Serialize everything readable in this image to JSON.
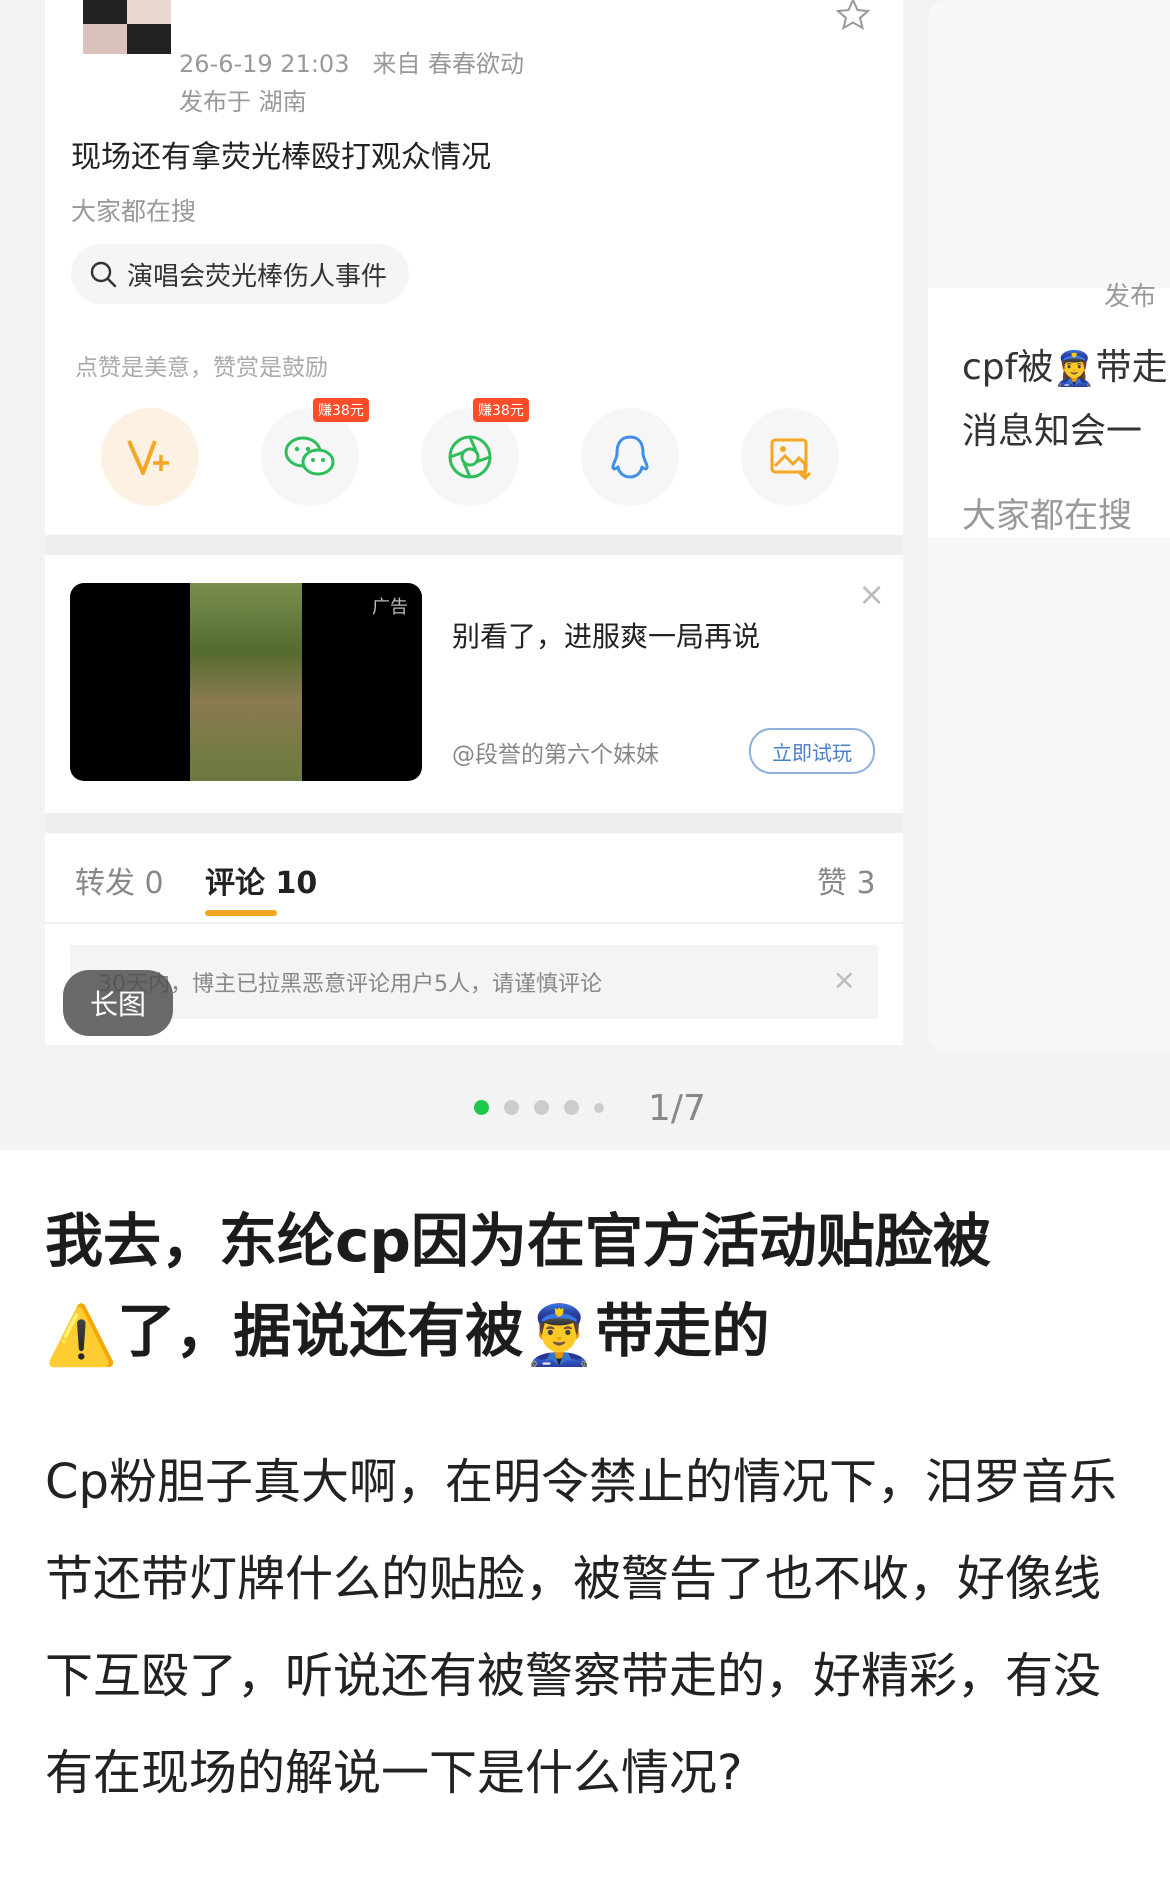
{
  "carousel": {
    "post": {
      "timestamp": "26-6-19 21:03",
      "source_prefix": "来自",
      "source": "春春欲动",
      "location": "发布于 湖南",
      "text": "现场还有拿荧光棒殴打观众情况",
      "trending_label": "大家都在搜",
      "trending_query": "演唱会荧光棒伤人事件",
      "reward_text": "点赞是美意，赞赏是鼓励",
      "share_buttons": [
        {
          "icon": "v-plus-icon",
          "badge": ""
        },
        {
          "icon": "wechat-icon",
          "badge": "赚38元"
        },
        {
          "icon": "moments-icon",
          "badge": "赚38元"
        },
        {
          "icon": "qq-icon",
          "badge": ""
        },
        {
          "icon": "save-image-icon",
          "badge": ""
        }
      ]
    },
    "ad": {
      "tag": "广告",
      "title": "别看了，进服爽一局再说",
      "source": "@段誉的第六个妹妹",
      "cta": "立即试玩",
      "close": "×"
    },
    "tabs": {
      "repost": "转发 0",
      "comments": "评论 10",
      "likes": "赞 3"
    },
    "notice": "30天内，博主已拉黑恶意评论用户5人，请谨慎评论",
    "notice_close": "×",
    "long_image_badge": "长图",
    "next_card": {
      "published": "发布",
      "line1a": "cpf被",
      "line1b": "带走",
      "line2": "消息知会一",
      "trending_label": "大家都在搜"
    },
    "pager": {
      "current": 1,
      "total": 7,
      "label": "1/7"
    }
  },
  "headline": {
    "part1": "我去，东纶cp因为在官方活动贴脸被",
    "part2": "了，据说还有被",
    "part3": "带走的"
  },
  "body": "Cp粉胆子真大啊，在明令禁止的情况下，汨罗音乐节还带灯牌什么的贴脸，被警告了也不收，好像线下互殴了，听说还有被警察带走的，好精彩，有没有在现场的解说一下是什么情况?",
  "colors": {
    "accent_orange": "#f5a623",
    "pager_active": "#1bc94a",
    "badge_red": "#ff4c2b",
    "wechat_green": "#2ebd59"
  }
}
